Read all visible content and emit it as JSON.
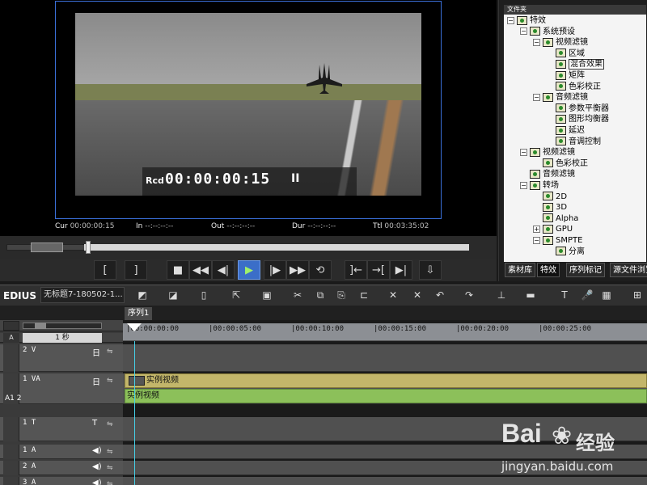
{
  "preview": {
    "rcd_label": "Rcd",
    "rcd_timecode": "00:00:00:15",
    "pause_mark": "II",
    "cur_label": "Cur",
    "cur_value": "00:00:00:15",
    "in_label": "In",
    "in_value": "--:--:--:--",
    "out_label": "Out",
    "out_value": "--:--:--:--",
    "dur_label": "Dur",
    "dur_value": "--:--:--:--",
    "ttl_label": "Ttl",
    "ttl_value": "00:03:35:02"
  },
  "transport": {
    "set_in": "[",
    "set_out": "]",
    "stop": "■",
    "rewind": "◀◀",
    "step_back": "◀|",
    "play": "▶",
    "step_forward": "|▶",
    "fast_forward": "▶▶",
    "loop": "⟲",
    "insert": "]←",
    "overwrite": "→[",
    "extract": "▶|",
    "lift": "⇩"
  },
  "bin": {
    "header": "文件夹",
    "tree": [
      {
        "label": "特效",
        "indent": 0,
        "expander": "−",
        "icon": "folder-icon"
      },
      {
        "label": "系统预设",
        "indent": 1,
        "expander": "−",
        "icon": "folder-icon"
      },
      {
        "label": "视频滤镜",
        "indent": 2,
        "expander": "−",
        "icon": "folder-icon"
      },
      {
        "label": "区域",
        "indent": 3,
        "expander": "",
        "icon": "effect-icon"
      },
      {
        "label": "混合效果",
        "indent": 3,
        "expander": "",
        "icon": "effect-icon",
        "selected": true
      },
      {
        "label": "矩阵",
        "indent": 3,
        "expander": "",
        "icon": "effect-icon"
      },
      {
        "label": "色彩校正",
        "indent": 3,
        "expander": "",
        "icon": "effect-icon"
      },
      {
        "label": "音频滤镜",
        "indent": 2,
        "expander": "−",
        "icon": "folder-icon"
      },
      {
        "label": "参数平衡器",
        "indent": 3,
        "expander": "",
        "icon": "effect-icon"
      },
      {
        "label": "图形均衡器",
        "indent": 3,
        "expander": "",
        "icon": "effect-icon"
      },
      {
        "label": "延迟",
        "indent": 3,
        "expander": "",
        "icon": "effect-icon"
      },
      {
        "label": "音调控制",
        "indent": 3,
        "expander": "",
        "icon": "effect-icon"
      },
      {
        "label": "视频滤镜",
        "indent": 1,
        "expander": "−",
        "icon": "folder-icon"
      },
      {
        "label": "色彩校正",
        "indent": 2,
        "expander": "",
        "icon": "effect-icon"
      },
      {
        "label": "音频滤镜",
        "indent": 1,
        "expander": "",
        "icon": "effect-icon"
      },
      {
        "label": "转场",
        "indent": 1,
        "expander": "−",
        "icon": "folder-icon"
      },
      {
        "label": "2D",
        "indent": 2,
        "expander": "",
        "icon": "effect-icon"
      },
      {
        "label": "3D",
        "indent": 2,
        "expander": "",
        "icon": "effect-icon"
      },
      {
        "label": "Alpha",
        "indent": 2,
        "expander": "",
        "icon": "effect-icon"
      },
      {
        "label": "GPU",
        "indent": 2,
        "expander": "+",
        "icon": "folder-icon"
      },
      {
        "label": "SMPTE",
        "indent": 2,
        "expander": "−",
        "icon": "folder-icon"
      },
      {
        "label": "分离",
        "indent": 3,
        "expander": "",
        "icon": "effect-icon"
      }
    ],
    "tabs": [
      "素材库",
      "特效",
      "序列标记",
      "源文件浏览"
    ],
    "active_tab": 1
  },
  "toolbar": {
    "app_name": "EDIUS",
    "project_title": "无标题7-180502-1..."
  },
  "timeline": {
    "sequence_tab": "序列1",
    "scale_label": "1 秒",
    "ruler_ticks": [
      "00:00:00:00",
      "00:00:05:00",
      "00:00:10:00",
      "00:00:15:00",
      "00:00:20:00",
      "00:00:25:00"
    ],
    "tracks": [
      {
        "name": "2 V",
        "mode": "日"
      },
      {
        "name": "1 VA",
        "mode": "日"
      },
      {
        "name": "1 T",
        "mode": "T"
      },
      {
        "name": "1 A",
        "mode": "◀)"
      },
      {
        "name": "2 A",
        "mode": "◀)"
      },
      {
        "name": "3 A",
        "mode": "◀)"
      }
    ],
    "video_clip": "实例视频",
    "audio_clip": "实例视频",
    "a_label": "A",
    "a12_label": "A1 2"
  },
  "watermark": {
    "brand": "Bai",
    "brand_cn": "经验",
    "url": "jingyan.baidu.com"
  },
  "colors": {
    "video_clip": "#c3b66a",
    "audio_clip": "#8cc05a",
    "play_button": "#3b6ec8",
    "cursor": "#46d0e8"
  }
}
